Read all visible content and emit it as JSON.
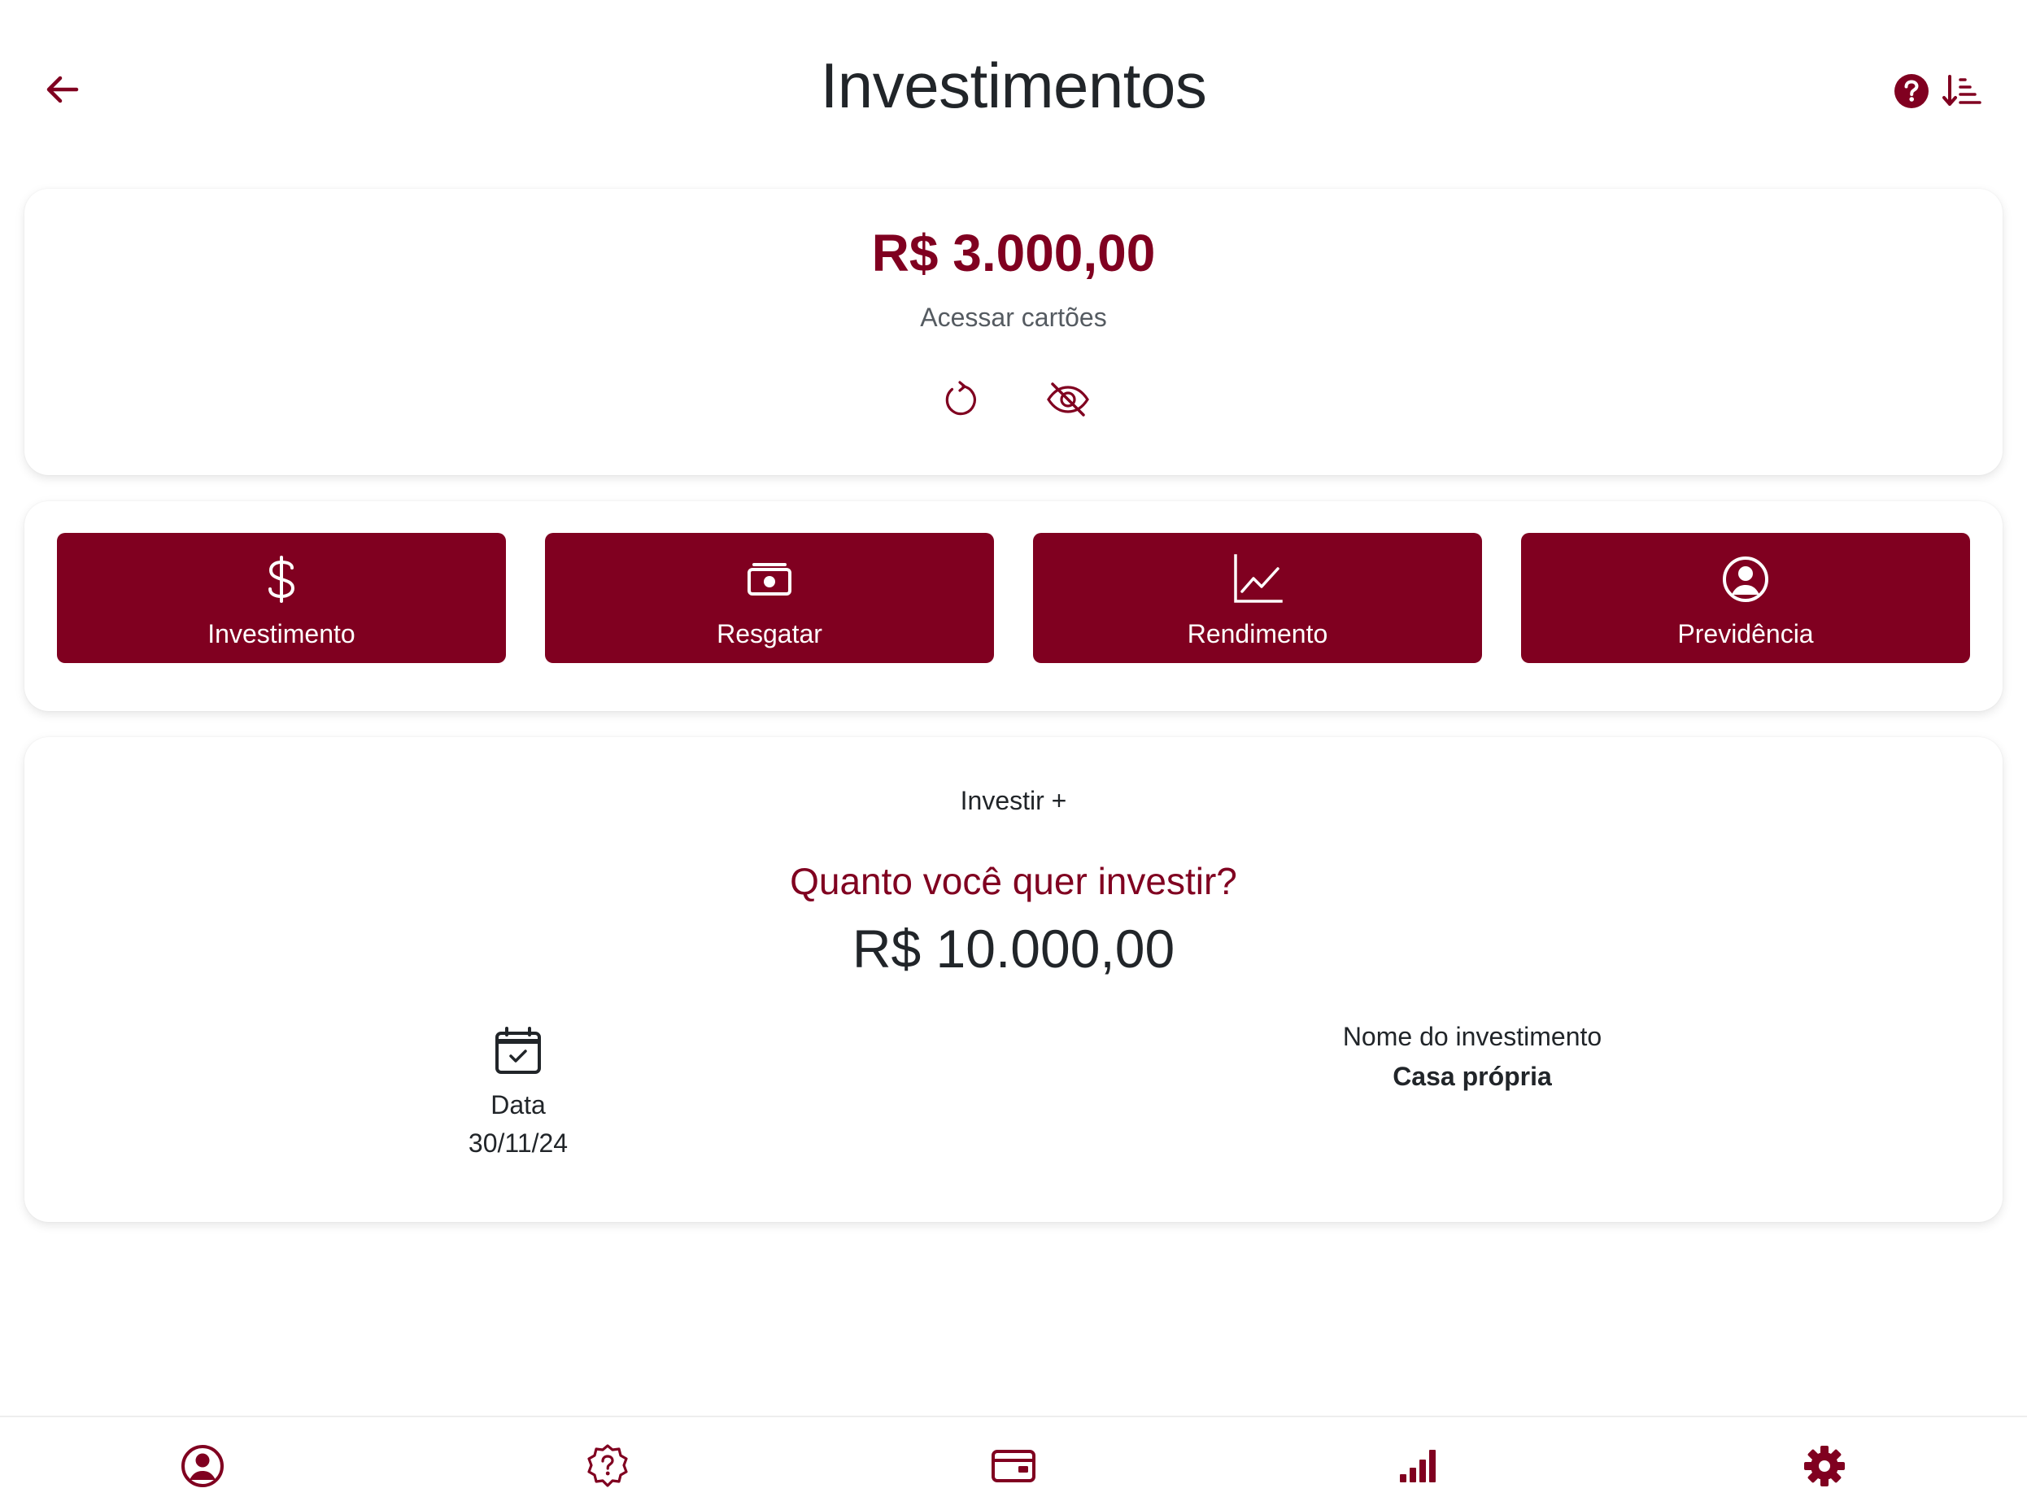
{
  "header": {
    "title": "Investimentos",
    "back_icon": "arrow-left-icon",
    "help_icon": "question-circle-icon",
    "sort_icon": "sort-descending-icon"
  },
  "balance": {
    "amount": "R$ 3.000,00",
    "subtitle": "Acessar cartões",
    "refresh_icon": "refresh-icon",
    "hide_icon": "eye-slash-icon"
  },
  "actions": [
    {
      "label": "Investimento",
      "icon": "dollar-icon"
    },
    {
      "label": "Resgatar",
      "icon": "cash-icon"
    },
    {
      "label": "Rendimento",
      "icon": "graph-up-icon"
    },
    {
      "label": "Previdência",
      "icon": "person-circle-icon"
    }
  ],
  "invest": {
    "link": "Investir +",
    "question": "Quanto você quer investir?",
    "amount": "R$ 10.000,00",
    "date_label": "Data",
    "date_value": "30/11/24",
    "name_label": "Nome do investimento",
    "name_value": "Casa própria"
  },
  "bottom_nav": [
    {
      "icon": "person-circle-icon"
    },
    {
      "icon": "question-badge-icon"
    },
    {
      "icon": "credit-card-icon"
    },
    {
      "icon": "bar-chart-icon"
    },
    {
      "icon": "gear-icon"
    }
  ],
  "colors": {
    "accent": "#800020",
    "text": "#212529",
    "muted": "#555b61",
    "background": "#ffffff"
  }
}
